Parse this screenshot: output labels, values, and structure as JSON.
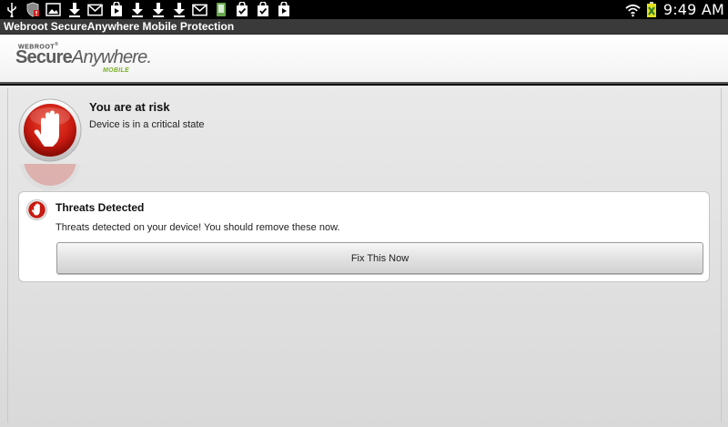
{
  "statusbar": {
    "left_icons": [
      "usb-icon",
      "shield-alert-icon",
      "image-icon",
      "download-icon",
      "gmail-icon",
      "play-store-icon",
      "download-icon",
      "download-icon",
      "download-icon",
      "gmail-icon",
      "app-icon",
      "check-bag-icon",
      "check-bag-icon",
      "play-store-icon"
    ],
    "right_icons": [
      "wifi-icon",
      "battery-icon"
    ],
    "time": "9:49 AM"
  },
  "titlebar": {
    "title": "Webroot SecureAnywhere Mobile Protection"
  },
  "logo": {
    "brand": "WEBROOT",
    "product_bold": "Secure",
    "product_italic": "Anywhere.",
    "edition": "MOBILE"
  },
  "status": {
    "title": "You are at risk",
    "subtitle": "Device is in a critical state",
    "icon": "hand-stop-icon"
  },
  "threat_card": {
    "title": "Threats Detected",
    "message": "Threats detected on your device! You should remove these now.",
    "button_label": "Fix This Now",
    "icon": "hand-stop-icon"
  },
  "colors": {
    "alert_red": "#d0201a",
    "logo_green": "#7ab02a",
    "title_bar": "#3a3a3a"
  }
}
